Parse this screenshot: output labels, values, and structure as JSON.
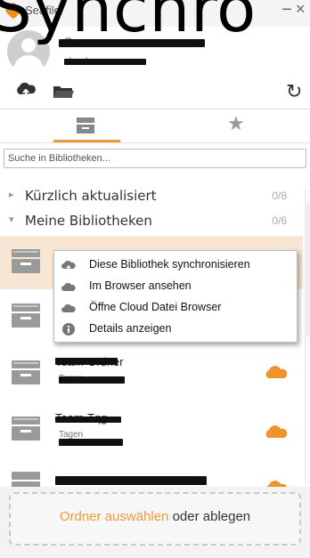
{
  "window": {
    "title": "Seafile",
    "overlay_text": "Synchro",
    "minimize": "−",
    "close": "×"
  },
  "account": {
    "email": "@",
    "server": "cloud"
  },
  "toolbar": {
    "upload_icon": "cloud-upload-icon",
    "folder_icon": "folder-icon",
    "refresh_icon": "refresh-icon",
    "refresh_glyph": "↻"
  },
  "tabs": [
    {
      "name": "repos",
      "icon": "repos-icon",
      "active": true
    },
    {
      "name": "starred",
      "icon": "star-icon",
      "glyph": "★"
    }
  ],
  "search": {
    "placeholder": "Suche in Bibliotheken..."
  },
  "sections": {
    "recent": {
      "label": "Kürzlich aktualisiert",
      "count": "0/8",
      "chevron": "▸"
    },
    "mine": {
      "label": "Meine Bibliotheken",
      "count": "0/6",
      "chevron": "▾"
    }
  },
  "repos": [
    {
      "name": "",
      "sub": ""
    },
    {
      "name": "",
      "sub": ""
    },
    {
      "name": "Team-Ordner",
      "sub": "Tagen"
    },
    {
      "name": "Team-Tqg",
      "sub": "Tagen"
    },
    {
      "name": "",
      "sub": ""
    }
  ],
  "context_menu": [
    {
      "label": "Diese Bibliothek synchronisieren",
      "icon": "sync-cloud-icon"
    },
    {
      "label": "Im Browser ansehen",
      "icon": "cloud-icon"
    },
    {
      "label": "Öffne Cloud Datei Browser",
      "icon": "cloud-icon"
    },
    {
      "label": "Details anzeigen",
      "icon": "info-icon"
    }
  ],
  "dropzone": {
    "link": "Ordner auswählen",
    "rest": " oder ablegen"
  },
  "colors": {
    "accent": "#f09a3e",
    "selection": "#f7e6d3",
    "cloud": "#f0922d"
  }
}
